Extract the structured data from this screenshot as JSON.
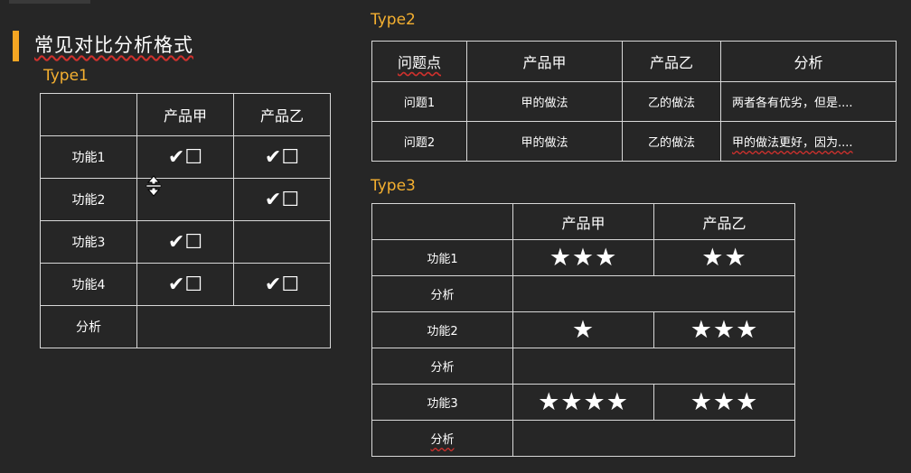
{
  "title": "常见对比分析格式",
  "type1": {
    "label": "Type1",
    "headers": [
      "",
      "产品甲",
      "产品乙"
    ],
    "rows": [
      {
        "feature": "功能1",
        "a": "✔☐",
        "b": "✔☐"
      },
      {
        "feature": "功能2",
        "a": "",
        "b": "✔☐"
      },
      {
        "feature": "功能3",
        "a": "✔☐",
        "b": ""
      },
      {
        "feature": "功能4",
        "a": "✔☐",
        "b": "✔☐"
      }
    ],
    "analysis_label": "分析"
  },
  "type2": {
    "label": "Type2",
    "headers": [
      "问题点",
      "产品甲",
      "产品乙",
      "分析"
    ],
    "rows": [
      {
        "issue": "问题1",
        "a": "甲的做法",
        "b": "乙的做法",
        "analysis": "两者各有优劣，但是...."
      },
      {
        "issue": "问题2",
        "a": "甲的做法",
        "b": "乙的做法",
        "analysis": "甲的做法更好，因为...."
      }
    ]
  },
  "type3": {
    "label": "Type3",
    "headers": [
      "",
      "产品甲",
      "产品乙"
    ],
    "rows": [
      {
        "feature": "功能1",
        "a": "★★★",
        "b": "★★"
      },
      {
        "feature": "功能2",
        "a": "★",
        "b": "★★★"
      },
      {
        "feature": "功能3",
        "a": "★★★★",
        "b": "★★★"
      }
    ],
    "analysis_label": "分析"
  },
  "colors": {
    "background": "#262626",
    "accent": "#f5a623",
    "type_label": "#f5b030",
    "grid_line": "#d8d8d8",
    "spellcheck": "#d0312d"
  },
  "icons": {
    "cursor": "resize-cursor-icon",
    "accent": "accent-bar"
  }
}
